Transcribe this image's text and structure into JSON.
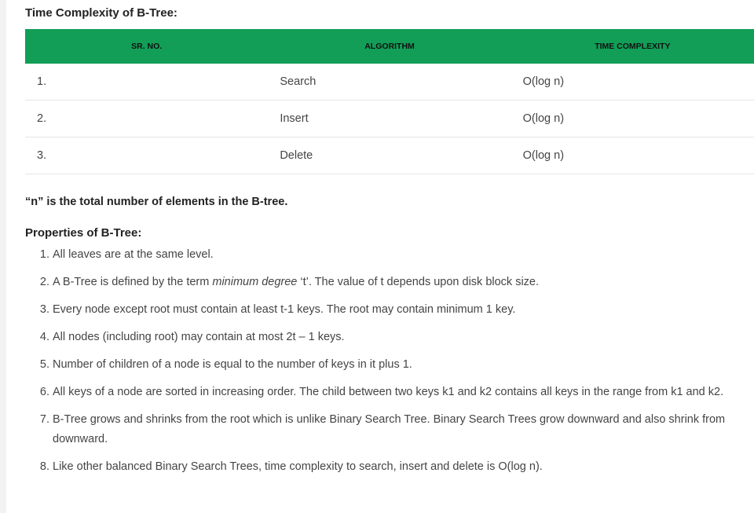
{
  "heading1": "Time Complexity of B-Tree:",
  "table": {
    "headers": [
      "SR. NO.",
      "ALGORITHM",
      "TIME COMPLEXITY"
    ],
    "rows": [
      [
        "1.",
        "Search",
        "O(log n)"
      ],
      [
        "2.",
        "Insert",
        "O(log n)"
      ],
      [
        "3.",
        "Delete",
        "O(log n)"
      ]
    ]
  },
  "note": "“n” is the total number of elements in the B-tree.",
  "heading2": "Properties of B-Tree:",
  "properties": [
    {
      "text": "All leaves are at the same level."
    },
    {
      "pre": "A B-Tree is defined by the term ",
      "em": "minimum degree",
      "post": " ‘t’. The value of t depends upon disk block size."
    },
    {
      "text": "Every node except root must contain at least t-1 keys. The root may contain minimum 1 key."
    },
    {
      "text": "All nodes (including root) may contain at most 2t – 1 keys."
    },
    {
      "text": "Number of children of a node is equal to the number of keys in it plus 1."
    },
    {
      "text": "All keys of a node are sorted in increasing order. The child between two keys k1 and k2 contains all keys in the range from k1 and k2."
    },
    {
      "text": "B-Tree grows and shrinks from the root which is unlike Binary Search Tree. Binary Search Trees grow downward and also shrink from downward."
    },
    {
      "text": "Like other balanced Binary Search Trees, time complexity to search, insert and delete is O(log n)."
    }
  ],
  "colors": {
    "header_bg": "#129e57"
  }
}
